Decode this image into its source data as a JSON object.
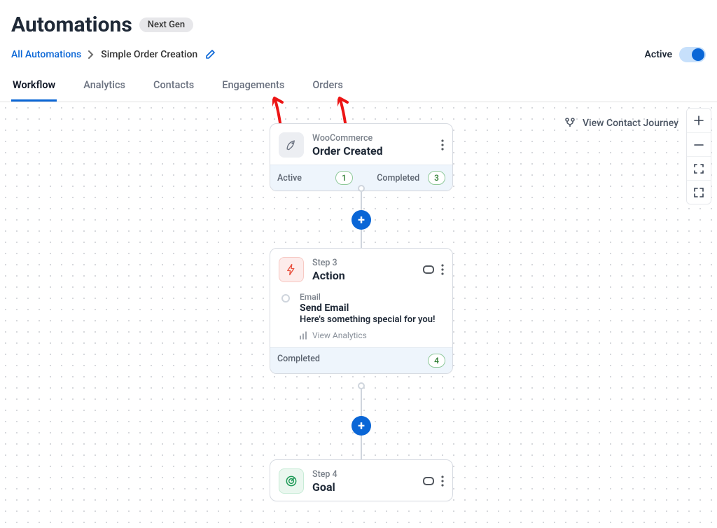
{
  "header": {
    "title": "Automations",
    "badge": "Next Gen"
  },
  "breadcrumb": {
    "root": "All Automations",
    "current": "Simple Order Creation"
  },
  "status": {
    "label": "Active",
    "on": true
  },
  "tabs": [
    "Workflow",
    "Analytics",
    "Contacts",
    "Engagements",
    "Orders"
  ],
  "active_tab": 0,
  "canvas": {
    "journey_link": "View Contact Journey",
    "trigger": {
      "source": "WooCommerce",
      "title": "Order Created",
      "active_label": "Active",
      "active_count": "1",
      "completed_label": "Completed",
      "completed_count": "3"
    },
    "action": {
      "step_label": "Step 3",
      "title": "Action",
      "channel": "Email",
      "name": "Send Email",
      "subject": "Here's something special for you!",
      "view_analytics": "View Analytics",
      "completed_label": "Completed",
      "completed_count": "4"
    },
    "goal": {
      "step_label": "Step 4",
      "title": "Goal"
    }
  }
}
